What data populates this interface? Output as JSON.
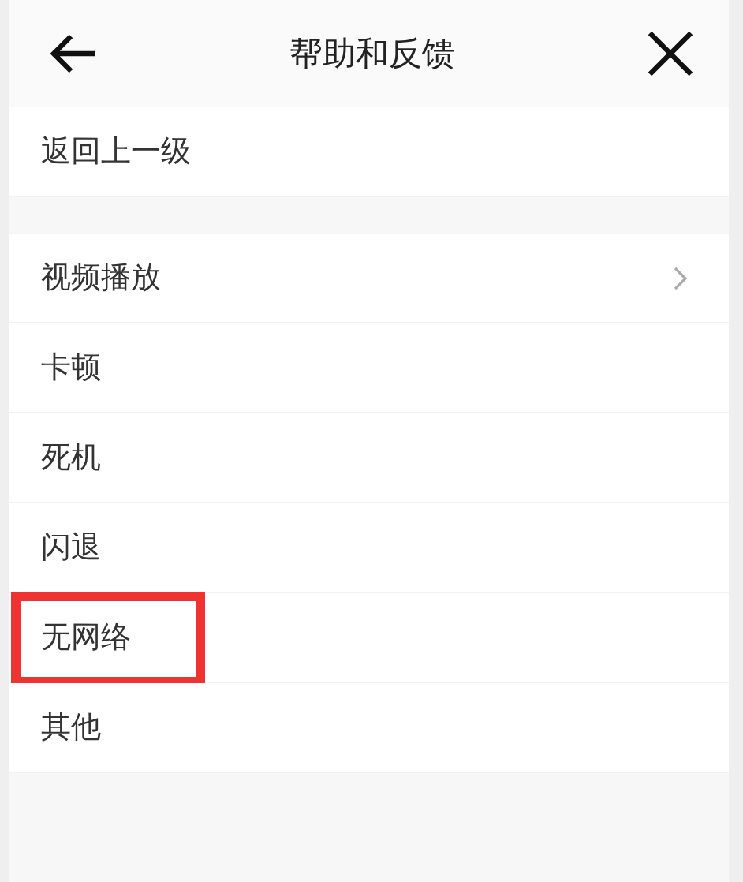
{
  "header": {
    "title": "帮助和反馈"
  },
  "back_item": {
    "label": "返回上一级"
  },
  "items": [
    {
      "label": "视频播放",
      "kind": "submenu",
      "highlighted": false
    },
    {
      "label": "卡顿",
      "kind": "plain",
      "highlighted": false
    },
    {
      "label": "死机",
      "kind": "plain",
      "highlighted": false
    },
    {
      "label": "闪退",
      "kind": "plain",
      "highlighted": false
    },
    {
      "label": "无网络",
      "kind": "plain",
      "highlighted": true
    },
    {
      "label": "其他",
      "kind": "plain",
      "highlighted": false
    }
  ]
}
